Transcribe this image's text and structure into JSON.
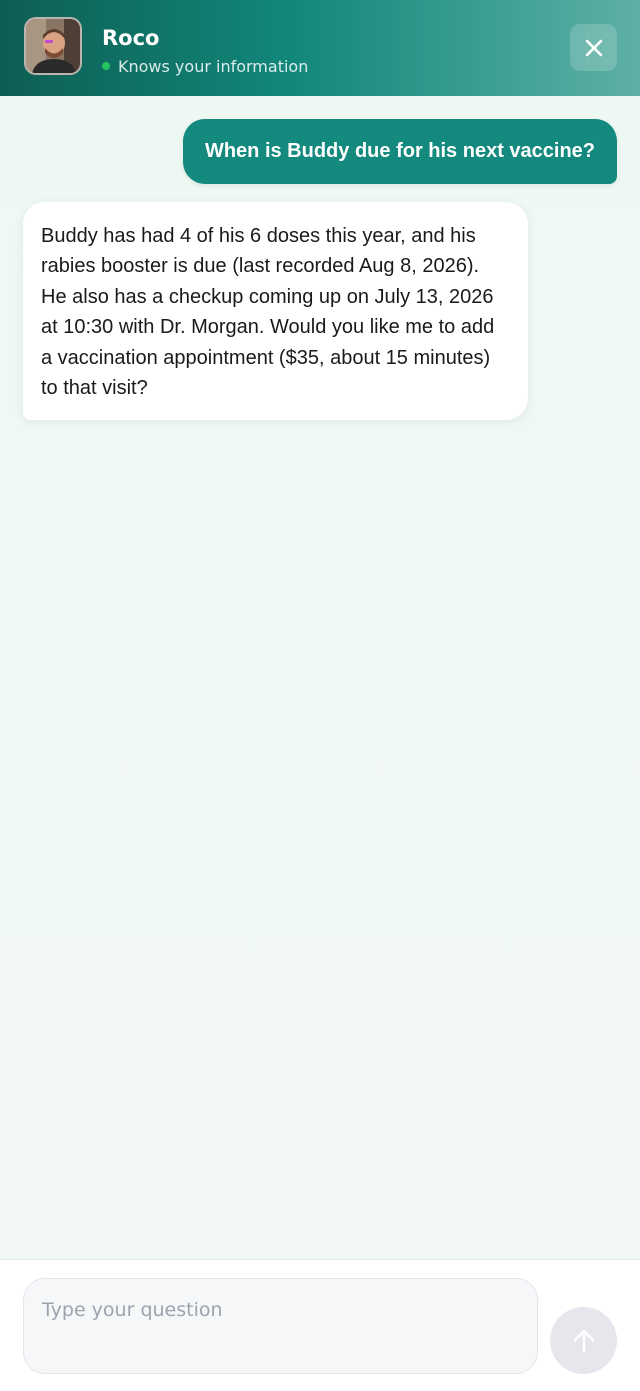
{
  "header": {
    "title": "Roco",
    "status_text": "Knows your information",
    "status_color": "#22c55e",
    "close_icon": "close-icon",
    "avatar": "assistant-avatar-photo"
  },
  "messages": [
    {
      "role": "user",
      "text": "When is Buddy due for his next vaccine?"
    },
    {
      "role": "assistant",
      "text": "Buddy has had 4 of his 6 doses this year, and his rabies booster is due (last recorded Aug 8, 2026). He also has a checkup coming up on July 13, 2026 at 10:30 with Dr. Morgan. Would you like me to add a vaccination appointment ($35, about 15 minutes) to that visit?"
    }
  ],
  "composer": {
    "placeholder": "Type your question",
    "value": "",
    "send_icon": "arrow-up-icon"
  },
  "colors": {
    "accent": "#138a7d",
    "header_start": "#0e5e52",
    "header_end": "#5eb0a5"
  }
}
